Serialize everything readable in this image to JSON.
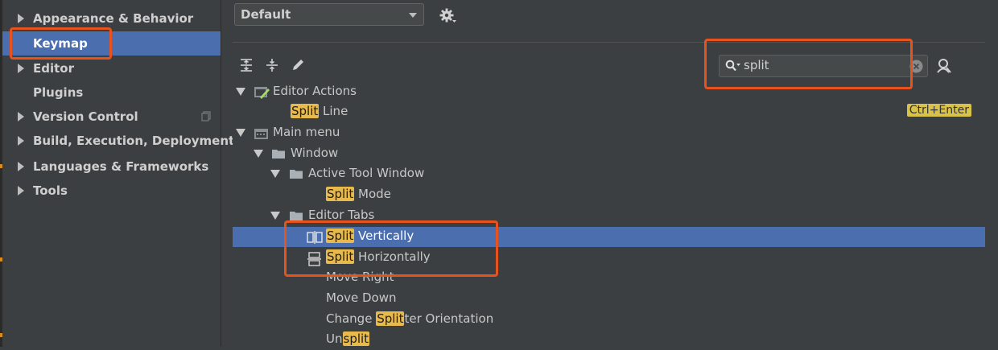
{
  "sidebar": {
    "items": [
      {
        "label": "Appearance & Behavior",
        "expandable": true,
        "selected": false
      },
      {
        "label": "Keymap",
        "expandable": false,
        "selected": true
      },
      {
        "label": "Editor",
        "expandable": true,
        "selected": false
      },
      {
        "label": "Plugins",
        "expandable": false,
        "selected": false
      },
      {
        "label": "Version Control",
        "expandable": true,
        "selected": false
      },
      {
        "label": "Build, Execution, Deployment",
        "expandable": true,
        "selected": false
      },
      {
        "label": "Languages & Frameworks",
        "expandable": true,
        "selected": false
      },
      {
        "label": "Tools",
        "expandable": true,
        "selected": false
      }
    ]
  },
  "keymap_selector": {
    "value": "Default"
  },
  "toolbar": {
    "icons": [
      "expand-all-icon",
      "collapse-all-icon",
      "edit-icon"
    ]
  },
  "search": {
    "value": "split"
  },
  "tree": {
    "rows": [
      {
        "prefix": "",
        "match": "",
        "suffix": "Editor Actions",
        "icon": "editor-actions-icon",
        "expanded": true
      },
      {
        "prefix": "",
        "match": "Split",
        "suffix": " Line",
        "shortcut": "Ctrl+Enter"
      },
      {
        "prefix": "",
        "match": "",
        "suffix": "Main menu",
        "icon": "main-menu-icon",
        "expanded": true
      },
      {
        "prefix": "",
        "match": "",
        "suffix": "Window",
        "icon": "folder-icon",
        "expanded": true
      },
      {
        "prefix": "",
        "match": "",
        "suffix": "Active Tool Window",
        "icon": "folder-icon",
        "expanded": true
      },
      {
        "prefix": "",
        "match": "Split",
        "suffix": " Mode"
      },
      {
        "prefix": "",
        "match": "",
        "suffix": "Editor Tabs",
        "icon": "folder-icon",
        "expanded": true
      },
      {
        "prefix": "",
        "match": "Split",
        "suffix": " Vertically",
        "icon": "split-vertically-icon",
        "selected": true
      },
      {
        "prefix": "",
        "match": "Split",
        "suffix": " Horizontally",
        "icon": "split-horizontally-icon"
      },
      {
        "prefix": "",
        "match": "",
        "suffix": "Move Right"
      },
      {
        "prefix": "",
        "match": "",
        "suffix": "Move Down"
      },
      {
        "prefix": "Change ",
        "match": "Split",
        "suffix": "ter Orientation"
      },
      {
        "prefix": "Un",
        "match": "split",
        "suffix": ""
      }
    ]
  },
  "colors": {
    "selection": "#4b6eaf",
    "match_highlight": "#e8b94b",
    "shortcut_badge": "#d9c24a",
    "annotation_outline": "#e8521d"
  }
}
